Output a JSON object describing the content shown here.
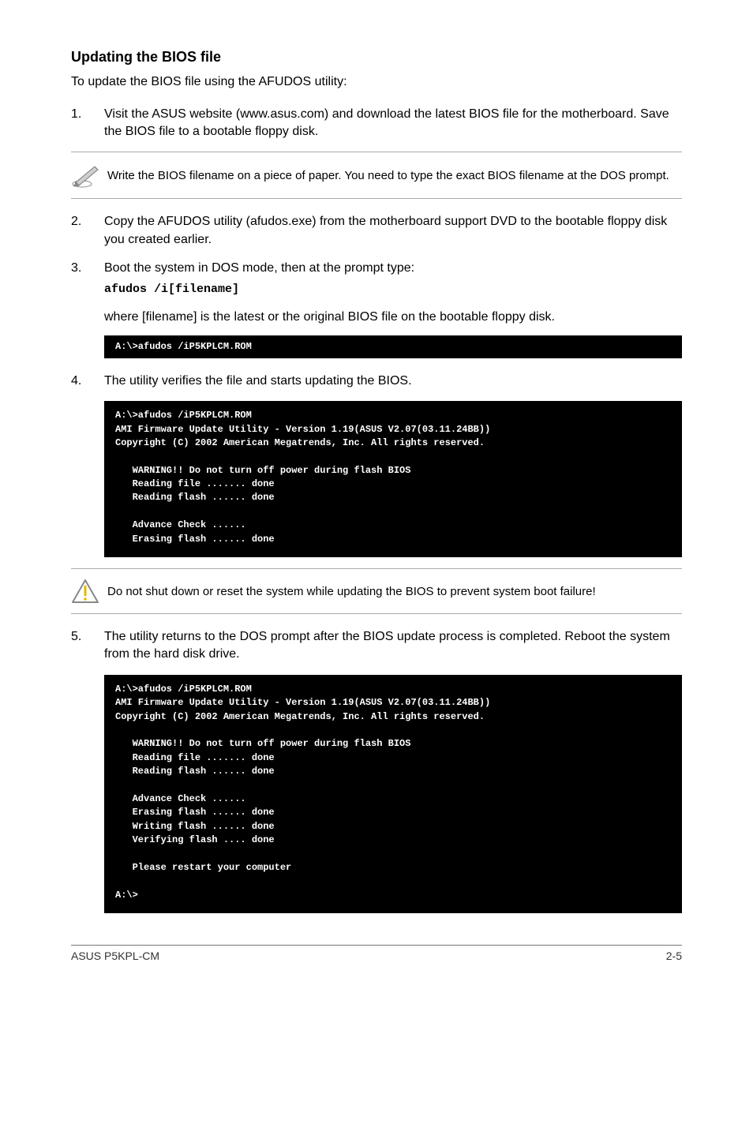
{
  "heading": "Updating the BIOS file",
  "intro": "To update the BIOS file using the AFUDOS utility:",
  "steps": {
    "s1": {
      "num": "1.",
      "text": "Visit the ASUS website (www.asus.com) and download the latest BIOS file for the motherboard. Save the BIOS file to a bootable floppy disk."
    },
    "s2": {
      "num": "2.",
      "text": "Copy the AFUDOS utility (afudos.exe) from the motherboard support DVD to the bootable floppy disk you created earlier."
    },
    "s3": {
      "num": "3.",
      "text": "Boot the system in DOS mode, then at the prompt type:",
      "cmd": "afudos /i[filename]"
    },
    "s4": {
      "num": "4.",
      "text": "The utility verifies the file and starts updating the BIOS."
    },
    "s5": {
      "num": "5.",
      "text": "The utility returns to the DOS prompt after the BIOS update process is completed. Reboot the system from the hard disk drive."
    }
  },
  "where_text": "where [filename] is the latest or the original BIOS file on the bootable floppy disk.",
  "note1": "Write the BIOS filename on a piece of paper. You need to type the exact BIOS filename at the DOS prompt.",
  "warn1": "Do not shut down or reset the system while updating the BIOS to prevent system boot failure!",
  "term1": "A:\\>afudos /iP5KPLCM.ROM",
  "term2": "A:\\>afudos /iP5KPLCM.ROM\nAMI Firmware Update Utility - Version 1.19(ASUS V2.07(03.11.24BB))\nCopyright (C) 2002 American Megatrends, Inc. All rights reserved.\n\n   WARNING!! Do not turn off power during flash BIOS\n   Reading file ....... done\n   Reading flash ...... done\n\n   Advance Check ......\n   Erasing flash ...... done",
  "term3": "A:\\>afudos /iP5KPLCM.ROM\nAMI Firmware Update Utility - Version 1.19(ASUS V2.07(03.11.24BB))\nCopyright (C) 2002 American Megatrends, Inc. All rights reserved.\n\n   WARNING!! Do not turn off power during flash BIOS\n   Reading file ....... done\n   Reading flash ...... done\n\n   Advance Check ......\n   Erasing flash ...... done\n   Writing flash ...... done\n   Verifying flash .... done\n\n   Please restart your computer\n\nA:\\>",
  "footer": {
    "left": "ASUS P5KPL-CM",
    "right": "2-5"
  }
}
